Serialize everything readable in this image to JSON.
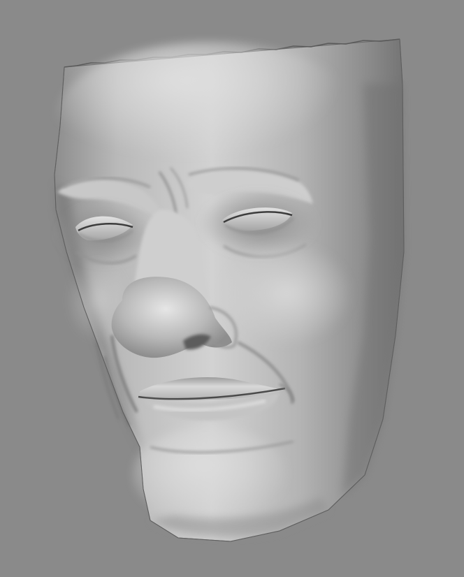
{
  "scene": {
    "subject": "face-mask-sculpt",
    "colors": {
      "background": "#8a8a8a",
      "surface_light": "#d8d8d8",
      "surface_mid": "#a8a8a8",
      "surface_dark": "#6a6a6a",
      "crease": "#4a4a4a"
    }
  }
}
